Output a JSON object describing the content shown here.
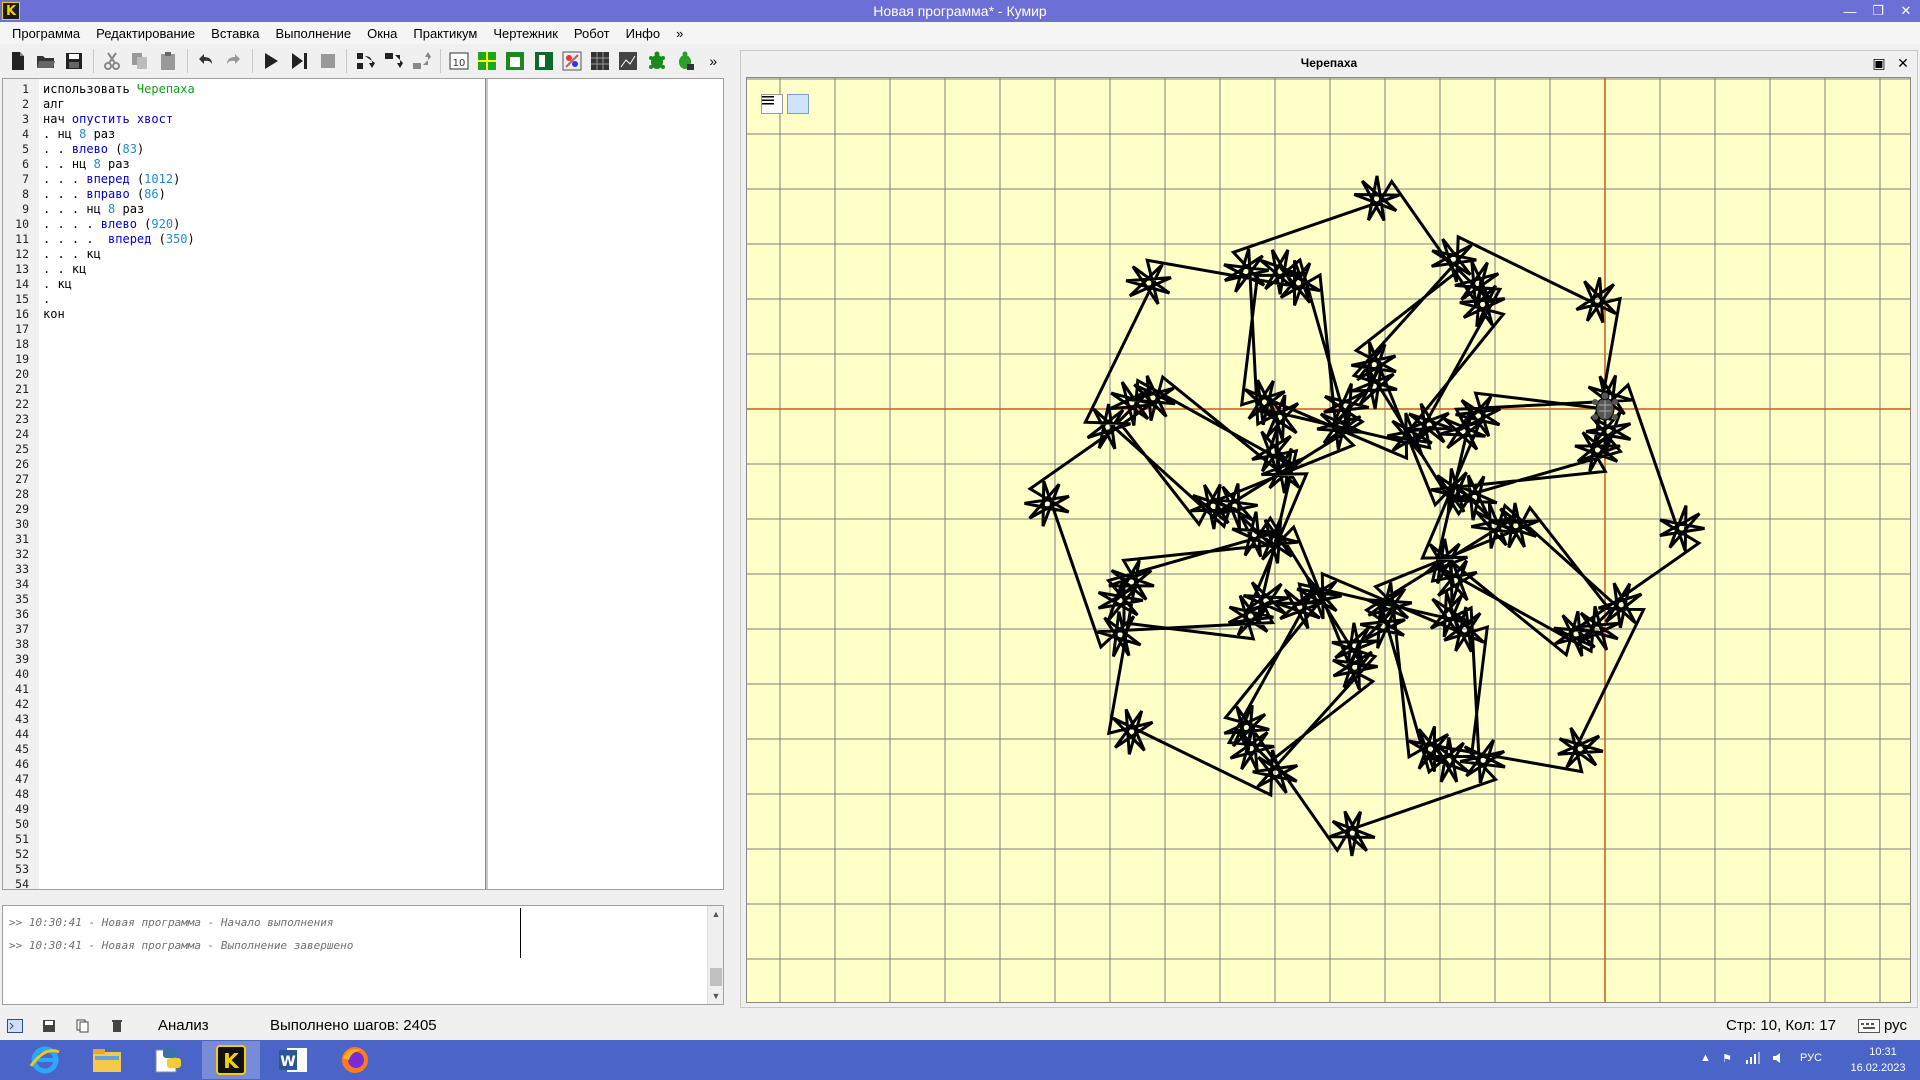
{
  "window": {
    "title": "Новая программа* - Кумир",
    "app_icon": "K"
  },
  "menu": [
    "Программа",
    "Редактирование",
    "Вставка",
    "Выполнение",
    "Окна",
    "Практикум",
    "Чертежник",
    "Робот",
    "Инфо",
    "»"
  ],
  "toolbar": {
    "icons": [
      "new-file-icon",
      "open-folder-icon",
      "save-icon",
      "cut-icon",
      "copy-icon",
      "paste-icon",
      "undo-icon",
      "redo-icon",
      "run-icon",
      "run-step-icon",
      "stop-icon",
      "step-over-icon",
      "step-in-icon",
      "step-out-icon",
      "variables-icon",
      "robot-field-icon",
      "robot-icon",
      "drawer-icon",
      "painter-icon",
      "grid-icon",
      "image-icon",
      "turtle-icon",
      "turtle-alt-icon"
    ],
    "more": "»"
  },
  "editor": {
    "lines": [
      [
        {
          "t": "использовать ",
          "c": ""
        },
        {
          "t": "Черепаха",
          "c": "mod"
        }
      ],
      [
        {
          "t": "алг",
          "c": ""
        }
      ],
      [
        {
          "t": "нач ",
          "c": ""
        },
        {
          "t": "опустить хвост",
          "c": "kw"
        }
      ],
      [
        {
          "t": ". нц ",
          "c": ""
        },
        {
          "t": "8",
          "c": "num"
        },
        {
          "t": " раз",
          "c": ""
        }
      ],
      [
        {
          "t": ". . ",
          "c": ""
        },
        {
          "t": "влево",
          "c": "kw"
        },
        {
          "t": " (",
          "c": ""
        },
        {
          "t": "83",
          "c": "num"
        },
        {
          "t": ")",
          "c": ""
        }
      ],
      [
        {
          "t": ". . нц ",
          "c": ""
        },
        {
          "t": "8",
          "c": "num"
        },
        {
          "t": " раз",
          "c": ""
        }
      ],
      [
        {
          "t": ". . . ",
          "c": ""
        },
        {
          "t": "вперед",
          "c": "kw"
        },
        {
          "t": " (",
          "c": ""
        },
        {
          "t": "1012",
          "c": "num"
        },
        {
          "t": ")",
          "c": ""
        }
      ],
      [
        {
          "t": ". . . ",
          "c": ""
        },
        {
          "t": "вправо",
          "c": "kw"
        },
        {
          "t": " (",
          "c": ""
        },
        {
          "t": "86",
          "c": "num"
        },
        {
          "t": ")",
          "c": ""
        }
      ],
      [
        {
          "t": ". . . нц ",
          "c": ""
        },
        {
          "t": "8",
          "c": "num"
        },
        {
          "t": " раз",
          "c": ""
        }
      ],
      [
        {
          "t": ". . . . ",
          "c": ""
        },
        {
          "t": "влево",
          "c": "kw"
        },
        {
          "t": " (",
          "c": ""
        },
        {
          "t": "920",
          "c": "num"
        },
        {
          "t": ")",
          "c": ""
        }
      ],
      [
        {
          "t": ". . . .  ",
          "c": ""
        },
        {
          "t": "вперед",
          "c": "kw"
        },
        {
          "t": " (",
          "c": ""
        },
        {
          "t": "350",
          "c": "num"
        },
        {
          "t": ")",
          "c": ""
        }
      ],
      [
        {
          "t": ". . . кц",
          "c": ""
        }
      ],
      [
        {
          "t": ". . кц",
          "c": ""
        }
      ],
      [
        {
          "t": ". кц",
          "c": ""
        }
      ],
      [
        {
          "t": ".",
          "c": ""
        }
      ],
      [
        {
          "t": "кон",
          "c": ""
        }
      ]
    ],
    "line_count": 54
  },
  "log": [
    ">> 10:30:41 - Новая программа - Начало выполнения",
    ">> 10:30:41 - Новая программа - Выполнение завершено"
  ],
  "turtle_window": {
    "title": "Черепаха"
  },
  "status": {
    "analysis": "Анализ",
    "steps": "Выполнено шагов: 2405",
    "position": "Стр: 10, Кол: 17",
    "lang": "рус"
  },
  "taskbar": {
    "apps": [
      "internet-explorer-icon",
      "file-explorer-icon",
      "python-icon",
      "kumir-icon",
      "word-icon",
      "firefox-icon"
    ],
    "tray_lang": "РУС",
    "time": "10:31",
    "date": "16.02.2023"
  },
  "colors": {
    "titlebar": "#6b6fd6",
    "canvas_bg": "#ffffc8",
    "grid": "#7f7f7f",
    "axis": "#c85a1e",
    "taskbar": "#4a64c8"
  }
}
